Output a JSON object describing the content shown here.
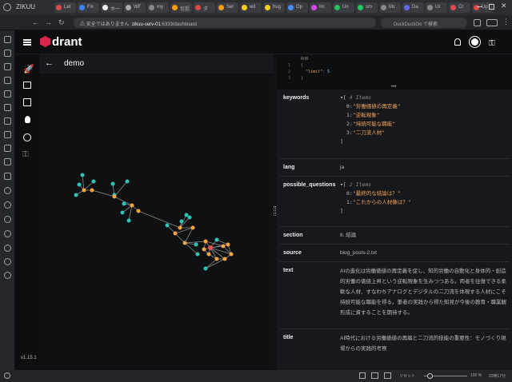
{
  "browser": {
    "brand": "ZIKUU",
    "tabs": [
      "Let",
      "Fix",
      "ホー",
      "WF",
      "my",
      "包括",
      "ダ",
      "Sel",
      "wit",
      "hug",
      "Op",
      "Im",
      "Un",
      "sm",
      "Mc",
      "Da",
      "UI",
      "Cr",
      "Up"
    ],
    "url_warning": "安全ではありません",
    "url_host": "zikuu-serv-01",
    "url_path": ":6333/dashboard",
    "search_placeholder": "DuckDuckGo で検索"
  },
  "app": {
    "logo": "drant",
    "collection_title": "demo",
    "version": "v1.15.1"
  },
  "code": {
    "line0": "RUN",
    "line1": "{",
    "line2_key": "\"limit\"",
    "line2_val": "5",
    "line3": "}"
  },
  "payload": {
    "keywords": {
      "key": "keywords",
      "meta": "4 Items",
      "items": [
        "\"労働価値の再定義\"",
        "\"逆転現象\"",
        "\"持続可能な職能\"",
        "\"二刀流人材\""
      ]
    },
    "lang": {
      "key": "lang",
      "value": "ja"
    },
    "possible_questions": {
      "key": "possible_questions",
      "meta": "2 Items",
      "items": [
        "\"最終的な結論は？\"",
        "\"これからの人材像は？\""
      ]
    },
    "section": {
      "key": "section",
      "value": "8. 結論"
    },
    "source": {
      "key": "source",
      "value": "blog_posts-2.txt"
    },
    "text": {
      "key": "text",
      "value": "AIの進化は労働価値の再定義を促し、知的労働の自動化と身体的・創造的労働の価値上昇という逆転現象を生みつつある。両者を往復できる柔軟な人材、すなわちアナログとデジタルの二刀流を体現する人材にこそ持続可能な職能を得る。筆者の実践から得た知見が今後の教育・職業観形成に資することを期待する。"
    },
    "title": {
      "key": "title",
      "value": "AI時代における労働価値の再編と二刀流的技能の重要性：モノづくり現場からの実践的考察"
    }
  },
  "status": {
    "reset": "リセット",
    "zoom": "100 %",
    "time": "22時17分"
  },
  "colors": {
    "node_teal": "#2ec4b6",
    "node_orange": "#f4a340",
    "node_red": "#e8514a",
    "accent": "#dc244c"
  }
}
